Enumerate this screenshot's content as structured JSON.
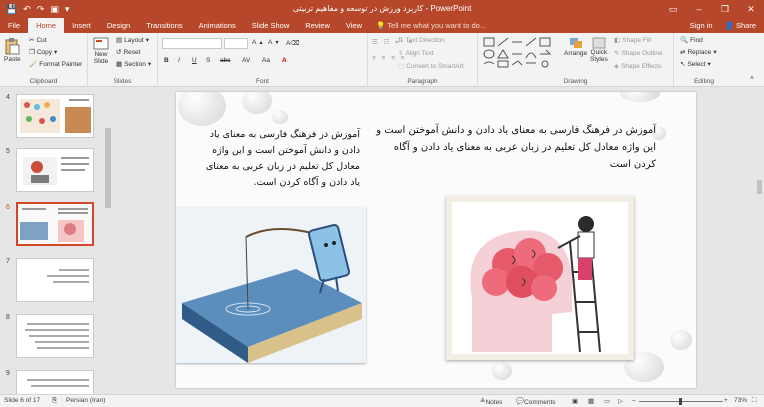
{
  "window": {
    "title": "کاربرد ورزش در توسعه و مفاهیم تربیتی  -  PowerPoint",
    "controls": [
      "–",
      "❐",
      "✕"
    ]
  },
  "tabs": [
    "File",
    "Home",
    "Insert",
    "Design",
    "Transitions",
    "Animations",
    "Slide Show",
    "Review",
    "View"
  ],
  "tell_me": "Tell me what you want to do...",
  "account": {
    "signin": "Sign in",
    "share": "Share"
  },
  "ribbon": {
    "clipboard": {
      "label": "Clipboard",
      "paste": "Paste",
      "cut": "Cut",
      "copy": "Copy",
      "format_painter": "Format Painter"
    },
    "slides": {
      "label": "Slides",
      "new_slide": "New",
      "new_slide2": "Slide",
      "layout": "Layout",
      "reset": "Reset",
      "section": "Section"
    },
    "font": {
      "label": "Font",
      "styles": [
        "B",
        "I",
        "U",
        "S",
        "abc",
        "AV",
        "Aa",
        "A"
      ]
    },
    "paragraph": {
      "label": "Paragraph",
      "text_direction": "Text Direction",
      "align_text": "Align Text",
      "smartart": "Convert to SmartArt"
    },
    "drawing": {
      "label": "Drawing",
      "arrange": "Arrange",
      "quick_styles": "Quick",
      "quick_styles2": "Styles",
      "shape_fill": "Shape Fill",
      "shape_outline": "Shape Outline",
      "shape_effects": "Shape Effects"
    },
    "editing": {
      "label": "Editing",
      "find": "Find",
      "replace": "Replace",
      "select": "Select"
    }
  },
  "thumbnails": [
    {
      "num": "4"
    },
    {
      "num": "5"
    },
    {
      "num": "6",
      "selected": true
    },
    {
      "num": "7"
    },
    {
      "num": "8"
    },
    {
      "num": "9"
    }
  ],
  "slide": {
    "text_right": "آموزش در فرهنگ فارسی به معنای یاد دادن و دانش آموختن است و این واژه معادل کل تعلیم در زبان عربی به معنای یاد دادن و آگاه کردن است",
    "text_left": "آموزش در فرهنگ فارسی به معنای یاد دادن و دانش آموختن است و این واژه معادل کل تعلیم در زبان عربی به معنای یاد دادن و آگاه کردن است."
  },
  "status": {
    "slide_of": "Slide 6 of 17",
    "language": "Persian (Iran)",
    "notes": "Notes",
    "comments": "Comments",
    "zoom": "73%"
  },
  "colors": {
    "accent": "#b7472a",
    "selection": "#d24726"
  }
}
